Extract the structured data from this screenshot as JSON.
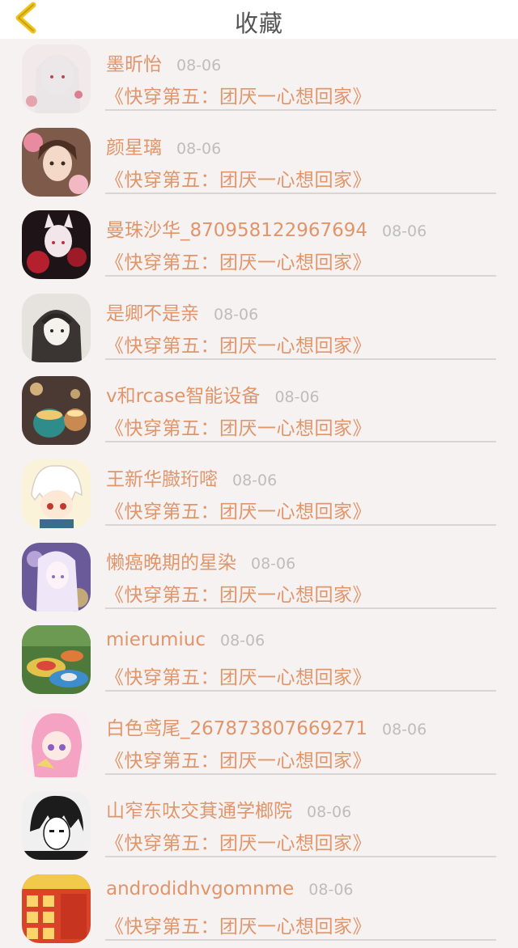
{
  "header": {
    "title": "收藏",
    "back_icon": "chevron-left-icon",
    "accent": "#f0c419"
  },
  "items": [
    {
      "name": "墨昕怡",
      "date": "08-06",
      "book": "《快穿第五：团厌一心想回家》"
    },
    {
      "name": "颜星璃",
      "date": "08-06",
      "book": "《快穿第五：团厌一心想回家》"
    },
    {
      "name": "曼珠沙华_870958122967694",
      "date": "08-06",
      "book": "《快穿第五：团厌一心想回家》"
    },
    {
      "name": "是卿不是亲",
      "date": "08-06",
      "book": "《快穿第五：团厌一心想回家》"
    },
    {
      "name": "v和rcase智能设备",
      "date": "08-06",
      "book": "《快穿第五：团厌一心想回家》"
    },
    {
      "name": "王新华臌珩嘧",
      "date": "08-06",
      "book": "《快穿第五：团厌一心想回家》"
    },
    {
      "name": "懒癌晚期的星染",
      "date": "08-06",
      "book": "《快穿第五：团厌一心想回家》"
    },
    {
      "name": "mierumiuc",
      "date": "08-06",
      "book": "《快穿第五：团厌一心想回家》"
    },
    {
      "name": "白色鸢尾_267873807669271",
      "date": "08-06",
      "book": "《快穿第五：团厌一心想回家》"
    },
    {
      "name": "山窄东呔交萁通学榔院",
      "date": "08-06",
      "book": "《快穿第五：团厌一心想回家》"
    },
    {
      "name": "androdidhvgomnme",
      "date": "08-06",
      "book": "《快穿第五：团厌一心想回家》"
    }
  ]
}
